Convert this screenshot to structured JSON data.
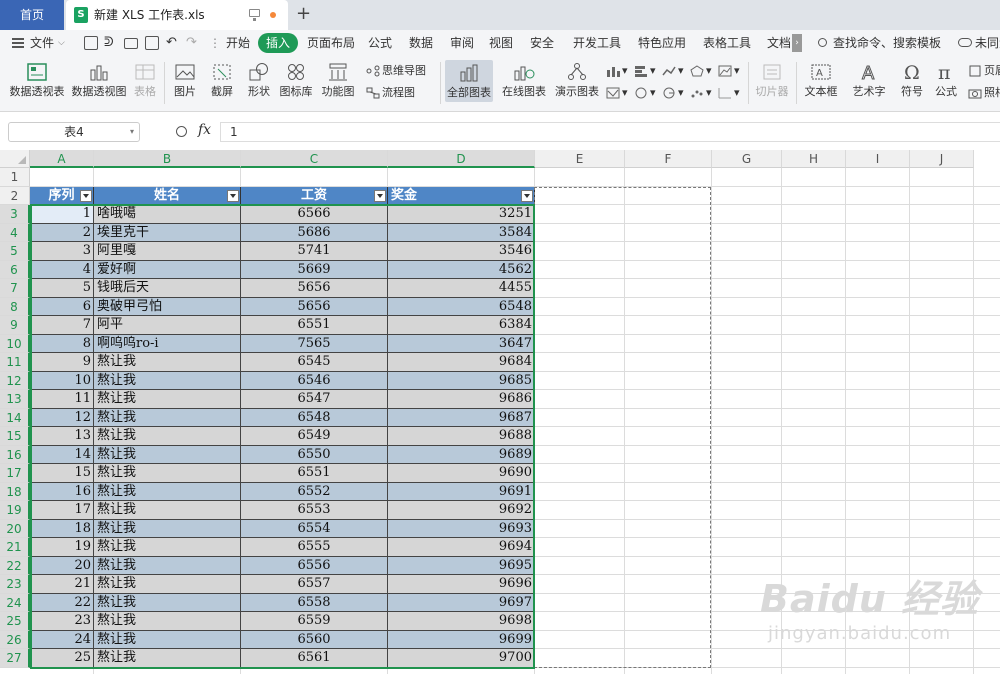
{
  "tabs": {
    "home": "首页",
    "doc_logo": "S",
    "doc_name": "新建 XLS 工作表.xls",
    "new_tab": "+"
  },
  "menu": {
    "file": "文件",
    "items": [
      "开始",
      "插入",
      "页面布局",
      "公式",
      "数据",
      "审阅",
      "视图",
      "安全",
      "开发工具",
      "特色应用",
      "表格工具",
      "文档"
    ],
    "active_index": 1,
    "search": "查找命令、搜索模板",
    "cloud": "未同步",
    "accent": "#1e9a57"
  },
  "ribbon": {
    "big": [
      {
        "label": "数据透视表",
        "icon": "pivot-table-icon"
      },
      {
        "label": "数据透视图",
        "icon": "pivot-chart-icon"
      },
      {
        "label": "表格",
        "icon": "table-icon"
      },
      {
        "label": "图片",
        "icon": "picture-icon"
      },
      {
        "label": "截屏",
        "icon": "screenshot-icon"
      },
      {
        "label": "形状",
        "icon": "shape-icon"
      },
      {
        "label": "图标库",
        "icon": "icon-library-icon"
      },
      {
        "label": "功能图",
        "icon": "function-chart-icon"
      },
      {
        "label": "全部图表",
        "icon": "all-charts-icon"
      },
      {
        "label": "在线图表",
        "icon": "online-chart-icon"
      },
      {
        "label": "演示图表",
        "icon": "demo-chart-icon"
      },
      {
        "label": "切片器",
        "icon": "slicer-icon"
      },
      {
        "label": "文本框",
        "icon": "textbox-icon"
      },
      {
        "label": "艺术字",
        "icon": "wordart-icon"
      },
      {
        "label": "符号",
        "icon": "symbol-icon"
      },
      {
        "label": "公式",
        "icon": "equation-icon"
      }
    ],
    "small": [
      {
        "label": "思维导图",
        "icon": "mindmap-icon"
      },
      {
        "label": "流程图",
        "icon": "flowchart-icon"
      },
      {
        "label": "页眉",
        "icon": "header-icon"
      },
      {
        "label": "照相",
        "icon": "camera-icon"
      }
    ]
  },
  "formula_bar": {
    "name_box": "表4",
    "fx": "fx",
    "value": "1"
  },
  "grid": {
    "columns": [
      "A",
      "B",
      "C",
      "D",
      "E",
      "F",
      "G",
      "H",
      "I",
      "J"
    ],
    "rows": [
      "1",
      "2",
      "3",
      "4",
      "5",
      "6",
      "7",
      "8",
      "9",
      "10",
      "11",
      "12",
      "13",
      "14",
      "15",
      "16",
      "17",
      "18",
      "19",
      "20",
      "21",
      "22",
      "23",
      "24",
      "25",
      "26",
      "27"
    ]
  },
  "table": {
    "headers": [
      "序列",
      "姓名",
      "工资",
      "奖金"
    ],
    "header_color": "#4f86c6",
    "band_colors": [
      "#d6d6d6",
      "#b8c9d9"
    ],
    "rows": [
      {
        "seq": "1",
        "name": "啥哦噶",
        "salary": "6566",
        "bonus": "3251"
      },
      {
        "seq": "2",
        "name": "埃里克干",
        "salary": "5686",
        "bonus": "3584"
      },
      {
        "seq": "3",
        "name": "阿里嘎",
        "salary": "5741",
        "bonus": "3546"
      },
      {
        "seq": "4",
        "name": "爱好啊",
        "salary": "5669",
        "bonus": "4562"
      },
      {
        "seq": "5",
        "name": "钱哦后天",
        "salary": "5656",
        "bonus": "4455"
      },
      {
        "seq": "6",
        "name": "奥破甲弓怕",
        "salary": "5656",
        "bonus": "6548"
      },
      {
        "seq": "7",
        "name": "阿平",
        "salary": "6551",
        "bonus": "6384"
      },
      {
        "seq": "8",
        "name": "啊呜呜ro-i",
        "salary": "7565",
        "bonus": "3647"
      },
      {
        "seq": "9",
        "name": "熬让我",
        "salary": "6545",
        "bonus": "9684"
      },
      {
        "seq": "10",
        "name": "熬让我",
        "salary": "6546",
        "bonus": "9685"
      },
      {
        "seq": "11",
        "name": "熬让我",
        "salary": "6547",
        "bonus": "9686"
      },
      {
        "seq": "12",
        "name": "熬让我",
        "salary": "6548",
        "bonus": "9687"
      },
      {
        "seq": "13",
        "name": "熬让我",
        "salary": "6549",
        "bonus": "9688"
      },
      {
        "seq": "14",
        "name": "熬让我",
        "salary": "6550",
        "bonus": "9689"
      },
      {
        "seq": "15",
        "name": "熬让我",
        "salary": "6551",
        "bonus": "9690"
      },
      {
        "seq": "16",
        "name": "熬让我",
        "salary": "6552",
        "bonus": "9691"
      },
      {
        "seq": "17",
        "name": "熬让我",
        "salary": "6553",
        "bonus": "9692"
      },
      {
        "seq": "18",
        "name": "熬让我",
        "salary": "6554",
        "bonus": "9693"
      },
      {
        "seq": "19",
        "name": "熬让我",
        "salary": "6555",
        "bonus": "9694"
      },
      {
        "seq": "20",
        "name": "熬让我",
        "salary": "6556",
        "bonus": "9695"
      },
      {
        "seq": "21",
        "name": "熬让我",
        "salary": "6557",
        "bonus": "9696"
      },
      {
        "seq": "22",
        "name": "熬让我",
        "salary": "6558",
        "bonus": "9697"
      },
      {
        "seq": "23",
        "name": "熬让我",
        "salary": "6559",
        "bonus": "9698"
      },
      {
        "seq": "24",
        "name": "熬让我",
        "salary": "6560",
        "bonus": "9699"
      },
      {
        "seq": "25",
        "name": "熬让我",
        "salary": "6561",
        "bonus": "9700"
      }
    ]
  },
  "watermark": {
    "brand": "Baidu 经验",
    "url": "jingyan.baidu.com"
  }
}
